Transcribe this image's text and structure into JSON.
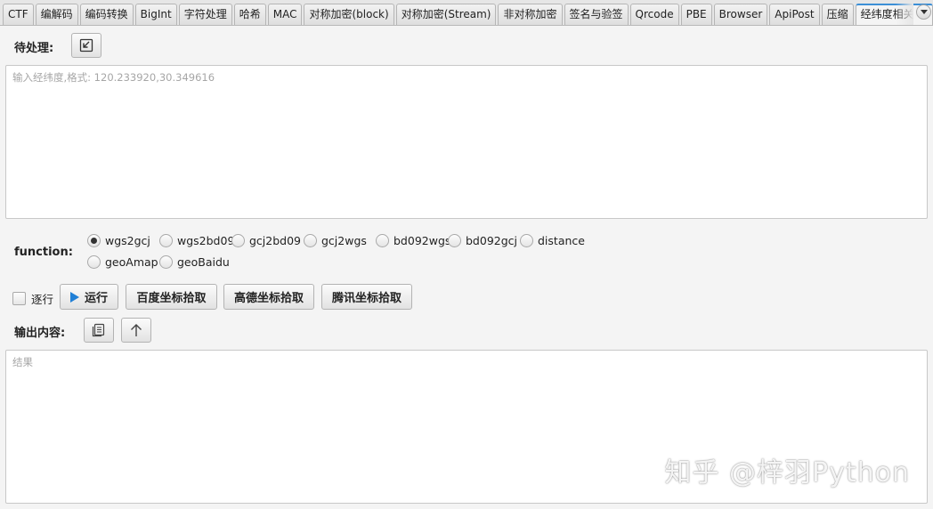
{
  "tabs": [
    {
      "label": "CTF"
    },
    {
      "label": "编解码"
    },
    {
      "label": "编码转换"
    },
    {
      "label": "BigInt"
    },
    {
      "label": "字符处理"
    },
    {
      "label": "哈希"
    },
    {
      "label": "MAC"
    },
    {
      "label": "对称加密(block)"
    },
    {
      "label": "对称加密(Stream)"
    },
    {
      "label": "非对称加密"
    },
    {
      "label": "签名与验签"
    },
    {
      "label": "Qrcode"
    },
    {
      "label": "PBE"
    },
    {
      "label": "Browser"
    },
    {
      "label": "ApiPost"
    },
    {
      "label": "压缩"
    },
    {
      "label": "经纬度相关",
      "active": true,
      "close": "✕"
    },
    {
      "label": "关"
    }
  ],
  "input_section": {
    "label": "待处理:",
    "import_icon": "import-icon",
    "placeholder": "输入经纬度,格式: 120.233920,30.349616",
    "value": ""
  },
  "function_section": {
    "label": "function:",
    "selected": "wgs2gcj",
    "options": [
      "wgs2gcj",
      "wgs2bd09",
      "gcj2bd09",
      "gcj2wgs",
      "bd092wgs",
      "bd092gcj",
      "distance",
      "geoAmap",
      "geoBaidu"
    ]
  },
  "actions": {
    "line_by_line_label": "逐行",
    "line_by_line_checked": false,
    "run_label": "运行",
    "run_icon": "play-icon",
    "baidu_pick_label": "百度坐标拾取",
    "amap_pick_label": "高德坐标拾取",
    "tencent_pick_label": "腾讯坐标拾取"
  },
  "output_section": {
    "label": "输出内容:",
    "copy_icon": "copy-icon",
    "upload_icon": "arrow-up-icon",
    "placeholder": "结果",
    "value": ""
  },
  "watermark": "知乎 @梓羽Python",
  "colors": {
    "accent": "#3c8fd6",
    "play": "#1f7fd6",
    "background": "#f4f4f4"
  }
}
